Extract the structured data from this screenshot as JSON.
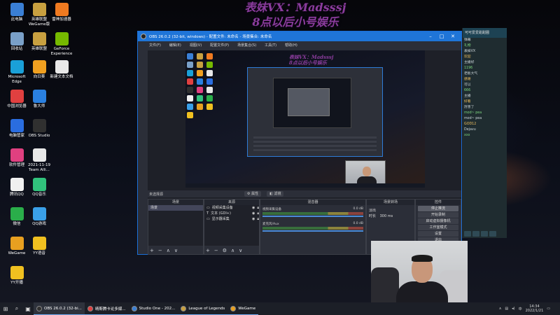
{
  "overlay": {
    "line1": "表妹VX：Madsssj",
    "line2": "8点以后小号娱乐"
  },
  "desktop_icons": [
    {
      "label": "此电脑",
      "icon": "computer-icon",
      "color": "#3a7fd5"
    },
    {
      "label": "英雄联盟 WeGame版",
      "icon": "lol-icon",
      "color": "#c8a040"
    },
    {
      "label": "雷神加速器",
      "icon": "leishen-icon",
      "color": "#f07a20"
    },
    {
      "label": "回收站",
      "icon": "recycle-bin-icon",
      "color": "#7aa0c8"
    },
    {
      "label": "英雄联盟",
      "icon": "lol-icon",
      "color": "#c8a040"
    },
    {
      "label": "GeForce Experience",
      "icon": "nvidia-icon",
      "color": "#76b900"
    },
    {
      "label": "Microsoft Edge",
      "icon": "edge-icon",
      "color": "#1aa0d8"
    },
    {
      "label": "向日葵",
      "icon": "sunflower-icon",
      "color": "#f0a020"
    },
    {
      "label": "新建文本文档",
      "icon": "text-file-icon",
      "color": "#e8e8e8"
    },
    {
      "label": "中国浏览器",
      "icon": "browser-icon",
      "color": "#e04040"
    },
    {
      "label": "鲁大师",
      "icon": "ludashi-icon",
      "color": "#2a80e0"
    },
    {
      "label": "电脑管家",
      "icon": "pc-manager-icon",
      "color": "#2a6de0"
    },
    {
      "label": "OBS Studio",
      "icon": "obs-icon",
      "color": "#303030"
    },
    {
      "label": "软件管理",
      "icon": "software-manager-icon",
      "color": "#e04080"
    },
    {
      "label": "2021-11-19 Team Alli...",
      "icon": "file-icon",
      "color": "#e8e8e8"
    },
    {
      "label": "腾讯QQ",
      "icon": "qq-icon",
      "color": "#f0f0f0"
    },
    {
      "label": "QQ音乐",
      "icon": "qq-music-icon",
      "color": "#31c27c"
    },
    {
      "label": "微信",
      "icon": "wechat-icon",
      "color": "#2aae4a"
    },
    {
      "label": "QQ游戏",
      "icon": "qq-game-icon",
      "color": "#3aa0e8"
    },
    {
      "label": "WeGame",
      "icon": "wegame-icon",
      "color": "#e8a020"
    },
    {
      "label": "YY语音",
      "icon": "yy-icon",
      "color": "#f0c020"
    },
    {
      "label": "YY开播",
      "icon": "yy-live-icon",
      "color": "#f0c020"
    }
  ],
  "obs": {
    "title": "OBS 26.0.2 (32-bit, windows) - 配置文件: 未命名 - 场景集合: 未命名",
    "menu": [
      "文件(F)",
      "编辑(E)",
      "视图(V)",
      "配置文件(P)",
      "场景集合(S)",
      "工具(T)",
      "帮助(H)"
    ],
    "scene_bar": {
      "label": "未选择源",
      "properties": "属性",
      "filters": "滤镜"
    },
    "docks": {
      "scenes": {
        "title": "场景",
        "items": [
          "场景"
        ]
      },
      "sources": {
        "title": "来源",
        "items": [
          "视频采集设备",
          "文本 (GDI+)",
          "显示器采集"
        ]
      },
      "mixer": {
        "title": "混音器",
        "tracks": [
          {
            "name": "视频采集设备",
            "db": "0.0 dB"
          },
          {
            "name": "麦克风/Aux",
            "db": "0.0 dB"
          }
        ]
      },
      "transitions": {
        "title": "场景转场",
        "type": "淡出",
        "duration_label": "时长",
        "duration": "300 ms"
      },
      "controls": {
        "title": "控件",
        "buttons": [
          "停止推流",
          "开始录制",
          "启动虚拟摄像机",
          "工作室模式",
          "设置",
          "退出"
        ]
      }
    },
    "status": {
      "fps": "CPU: 12%",
      "time": "00:00:00"
    }
  },
  "chat": {
    "header": "可可爱爱甜甜圈",
    "lines": [
      "弹幕",
      "礼物",
      "表妹VX",
      "欢迎",
      "主播好",
      "1196",
      "老板大气",
      "感谢",
      "可以",
      "666",
      "主播",
      "好看",
      "厉害了",
      "mod~ pea",
      "mod~ pea",
      "GOD12",
      "Dejavu",
      "xxx"
    ]
  },
  "taskbar": {
    "apps": [
      {
        "label": "OBS 26.0.2 (32-bi...",
        "icon": "obs-icon",
        "color": "#303030",
        "active": true
      },
      {
        "label": "晴斯腾卡论多媒...",
        "icon": "app-icon",
        "color": "#e04040",
        "active": false
      },
      {
        "label": "Studio One - 202...",
        "icon": "studio-one-icon",
        "color": "#3a7fd5",
        "active": false
      },
      {
        "label": "League of Legends",
        "icon": "lol-icon",
        "color": "#c8a040",
        "active": false
      },
      {
        "label": "WeGame",
        "icon": "wegame-icon",
        "color": "#e8a020",
        "active": false
      }
    ],
    "time": "14:34",
    "date": "2022/1/21"
  }
}
